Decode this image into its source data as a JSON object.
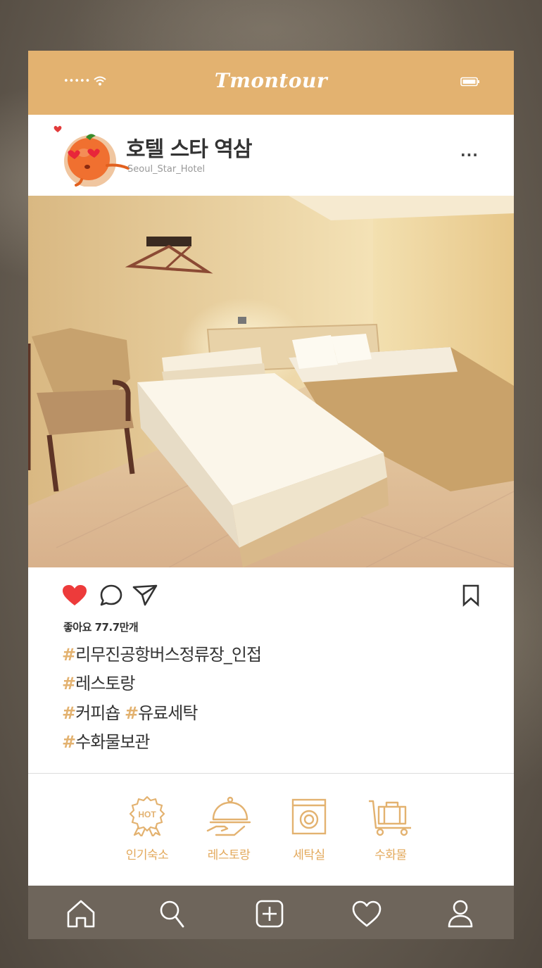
{
  "status_bar": {
    "signal": "•••••",
    "brand": "Tmontour",
    "color": "#e3b270"
  },
  "profile": {
    "name": "호텔 스타 역삼",
    "username": "Seoul_Star_Hotel",
    "more": "..."
  },
  "post": {
    "likes": "좋아요 77.7만개",
    "liked": true,
    "hashtags": [
      [
        {
          "h": "#",
          "t": "리무진공항버스정류장_인접"
        }
      ],
      [
        {
          "h": "#",
          "t": "레스토랑"
        }
      ],
      [
        {
          "h": "#",
          "t": "커피숍 "
        },
        {
          "h": "#",
          "t": "유료세탁"
        }
      ],
      [
        {
          "h": "#",
          "t": "수화물보관"
        }
      ]
    ]
  },
  "amenities": [
    {
      "label": "인기숙소",
      "icon": "hot-badge-icon"
    },
    {
      "label": "레스토랑",
      "icon": "cloche-icon"
    },
    {
      "label": "세탁실",
      "icon": "washing-machine-icon"
    },
    {
      "label": "수화물",
      "icon": "luggage-cart-icon"
    }
  ],
  "tabbar": [
    "home-icon",
    "search-icon",
    "add-icon",
    "heart-icon",
    "profile-icon"
  ]
}
